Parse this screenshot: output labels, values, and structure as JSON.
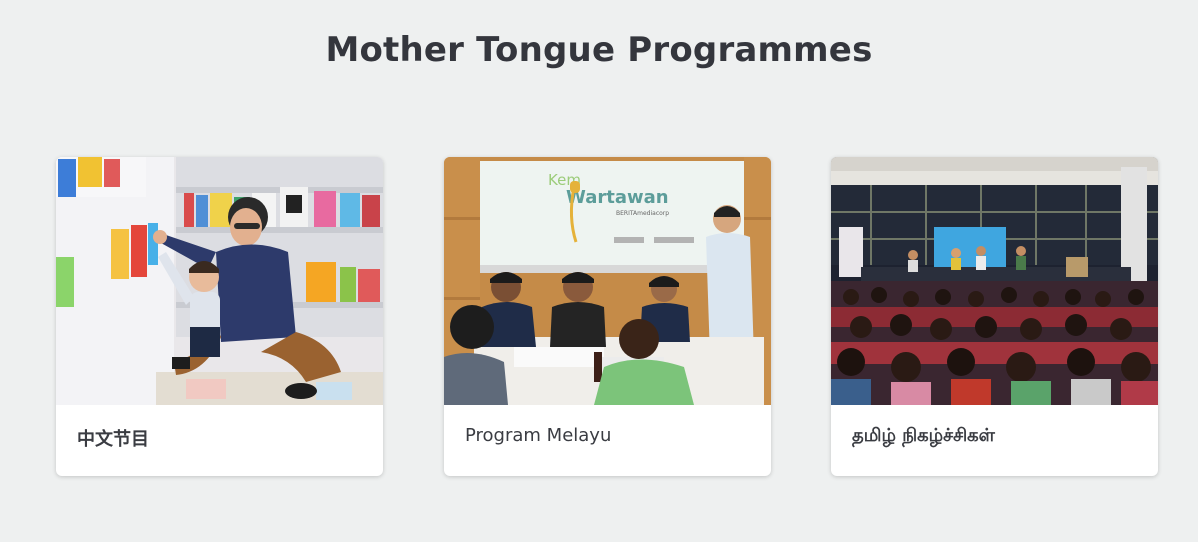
{
  "section": {
    "title": "Mother Tongue Programmes"
  },
  "cards": [
    {
      "label": "中文节目",
      "image": "photo-man-and-child-reading-books-at-library-shelf"
    },
    {
      "label": "Program Melayu",
      "image": "photo-students-at-table-with-projector-screen",
      "screen_text": {
        "line1": "Kem",
        "line2": "Wartawan",
        "line3": "BERITAmediacorp"
      }
    },
    {
      "label": "தமிழ் நிகழ்ச்சிகள்",
      "image": "photo-audience-watching-stage-panel-event"
    }
  ],
  "colors": {
    "background": "#eef0f0",
    "card": "#ffffff",
    "title": "#34363d"
  }
}
